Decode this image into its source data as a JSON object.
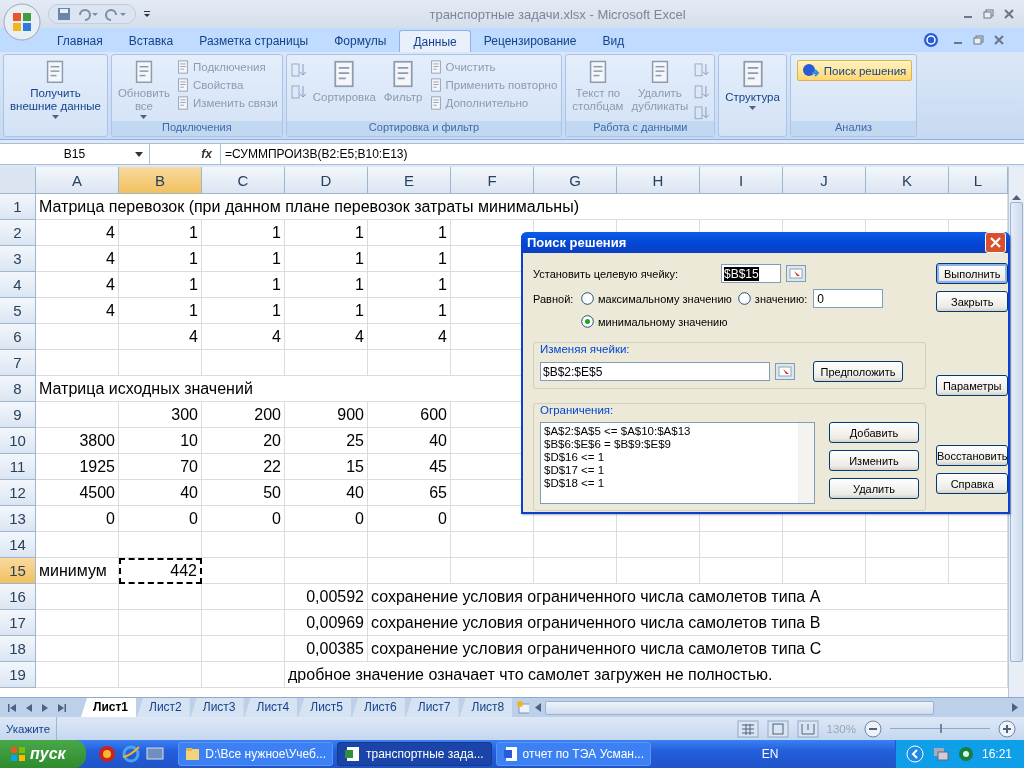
{
  "window": {
    "title": "транспортные задачи.xlsx - Microsoft Excel"
  },
  "tabs": [
    {
      "label": "Главная",
      "selected": false
    },
    {
      "label": "Вставка",
      "selected": false
    },
    {
      "label": "Разметка страницы",
      "selected": false
    },
    {
      "label": "Формулы",
      "selected": false
    },
    {
      "label": "Данные",
      "selected": true
    },
    {
      "label": "Рецензирование",
      "selected": false
    },
    {
      "label": "Вид",
      "selected": false
    }
  ],
  "ribbon": [
    {
      "items": [
        {
          "kind": "large",
          "label": "Получить\nвнешние данные",
          "disabled": false,
          "dropdown": true
        }
      ]
    },
    {
      "label": "Подключения",
      "items": [
        {
          "kind": "large",
          "label": "Обновить\nвсе",
          "disabled": true,
          "dropdown": true
        },
        {
          "kind": "stack",
          "children": [
            {
              "label": "Подключения",
              "disabled": true
            },
            {
              "label": "Свойства",
              "disabled": true
            },
            {
              "label": "Изменить связи",
              "disabled": true
            }
          ]
        }
      ]
    },
    {
      "label": "Сортировка и фильтр",
      "items": [
        {
          "kind": "sorticons",
          "disabled": true
        },
        {
          "kind": "large",
          "label": "Сортировка",
          "disabled": true,
          "dropdown": false
        },
        {
          "kind": "large",
          "label": "Фильтр",
          "disabled": true,
          "dropdown": false
        },
        {
          "kind": "stack",
          "children": [
            {
              "label": "Очистить",
              "disabled": true
            },
            {
              "label": "Применить повторно",
              "disabled": true
            },
            {
              "label": "Дополнительно",
              "disabled": true
            }
          ]
        }
      ]
    },
    {
      "label": "Работа с данными",
      "items": [
        {
          "kind": "large",
          "label": "Текст по\nстолбцам",
          "disabled": true,
          "dropdown": false
        },
        {
          "kind": "large",
          "label": "Удалить\nдубликаты",
          "disabled": true,
          "dropdown": false
        },
        {
          "kind": "toolicons",
          "disabled": true
        }
      ]
    },
    {
      "items": [
        {
          "kind": "large",
          "label": "Структура",
          "disabled": false,
          "dropdown": true
        }
      ]
    },
    {
      "label": "Анализ",
      "items": [
        {
          "kind": "highlight",
          "label": "Поиск решения",
          "disabled": false
        }
      ]
    }
  ],
  "formula_bar": {
    "name_box": "B15",
    "fx": "fx",
    "formula": "=СУММПРОИЗВ(B2:E5;B10:E13)"
  },
  "columns": [
    "A",
    "B",
    "C",
    "D",
    "E",
    "F",
    "G",
    "H",
    "I",
    "J",
    "K",
    "L"
  ],
  "rows": [
    {
      "header": "1",
      "cells": [
        {
          "text": "Матрица перевозок (при данном плане перевозок затраты минимальны)",
          "kind": "text"
        }
      ]
    },
    {
      "header": "2",
      "cells": [
        {
          "text": "4",
          "kind": "number"
        },
        {
          "text": "1",
          "kind": "number"
        },
        {
          "text": "1",
          "kind": "number"
        },
        {
          "text": "1",
          "kind": "number"
        },
        {
          "text": "1",
          "kind": "number"
        }
      ]
    },
    {
      "header": "3",
      "cells": [
        {
          "text": "4",
          "kind": "number"
        },
        {
          "text": "1",
          "kind": "number"
        },
        {
          "text": "1",
          "kind": "number"
        },
        {
          "text": "1",
          "kind": "number"
        },
        {
          "text": "1",
          "kind": "number"
        }
      ]
    },
    {
      "header": "4",
      "cells": [
        {
          "text": "4",
          "kind": "number"
        },
        {
          "text": "1",
          "kind": "number"
        },
        {
          "text": "1",
          "kind": "number"
        },
        {
          "text": "1",
          "kind": "number"
        },
        {
          "text": "1",
          "kind": "number"
        }
      ]
    },
    {
      "header": "5",
      "cells": [
        {
          "text": "4",
          "kind": "number"
        },
        {
          "text": "1",
          "kind": "number"
        },
        {
          "text": "1",
          "kind": "number"
        },
        {
          "text": "1",
          "kind": "number"
        },
        {
          "text": "1",
          "kind": "number"
        }
      ]
    },
    {
      "header": "6",
      "cells": [
        null,
        {
          "text": "4",
          "kind": "number"
        },
        {
          "text": "4",
          "kind": "number"
        },
        {
          "text": "4",
          "kind": "number"
        },
        {
          "text": "4",
          "kind": "number"
        }
      ]
    },
    {
      "header": "7",
      "cells": []
    },
    {
      "header": "8",
      "cells": [
        {
          "text": "Матрица исходных значений",
          "kind": "text"
        }
      ]
    },
    {
      "header": "9",
      "cells": [
        null,
        {
          "text": "300",
          "kind": "number"
        },
        {
          "text": "200",
          "kind": "number"
        },
        {
          "text": "900",
          "kind": "number"
        },
        {
          "text": "600",
          "kind": "number"
        }
      ]
    },
    {
      "header": "10",
      "cells": [
        {
          "text": "3800",
          "kind": "number"
        },
        {
          "text": "10",
          "kind": "number"
        },
        {
          "text": "20",
          "kind": "number"
        },
        {
          "text": "25",
          "kind": "number"
        },
        {
          "text": "40",
          "kind": "number"
        }
      ]
    },
    {
      "header": "11",
      "cells": [
        {
          "text": "1925",
          "kind": "number"
        },
        {
          "text": "70",
          "kind": "number"
        },
        {
          "text": "22",
          "kind": "number"
        },
        {
          "text": "15",
          "kind": "number"
        },
        {
          "text": "45",
          "kind": "number"
        }
      ]
    },
    {
      "header": "12",
      "cells": [
        {
          "text": "4500",
          "kind": "number"
        },
        {
          "text": "40",
          "kind": "number"
        },
        {
          "text": "50",
          "kind": "number"
        },
        {
          "text": "40",
          "kind": "number"
        },
        {
          "text": "65",
          "kind": "number"
        }
      ]
    },
    {
      "header": "13",
      "cells": [
        {
          "text": "0",
          "kind": "number"
        },
        {
          "text": "0",
          "kind": "number"
        },
        {
          "text": "0",
          "kind": "number"
        },
        {
          "text": "0",
          "kind": "number"
        },
        {
          "text": "0",
          "kind": "number"
        }
      ]
    },
    {
      "header": "14",
      "cells": []
    },
    {
      "header": "15",
      "cells": [
        {
          "text": "минимум",
          "kind": "text"
        },
        {
          "text": "442",
          "kind": "number",
          "selected": true
        }
      ]
    },
    {
      "header": "16",
      "cells": [
        null,
        null,
        null,
        {
          "text": "0,00592",
          "kind": "number"
        },
        {
          "text": "сохранение условия ограниченного числа самолетов типа А",
          "kind": "text"
        }
      ]
    },
    {
      "header": "17",
      "cells": [
        null,
        null,
        null,
        {
          "text": "0,00969",
          "kind": "number"
        },
        {
          "text": "сохранение условия ограниченного числа самолетов типа В",
          "kind": "text"
        }
      ]
    },
    {
      "header": "18",
      "cells": [
        null,
        null,
        null,
        {
          "text": "0,00385",
          "kind": "number"
        },
        {
          "text": "сохранение условия ограниченного числа самолетов типа С",
          "kind": "text"
        }
      ]
    },
    {
      "header": "19",
      "cells": [
        null,
        null,
        null,
        {
          "text": "дробное значение означает что самолет загружен не полностью.",
          "kind": "text"
        }
      ]
    }
  ],
  "sheet_tabs": [
    {
      "label": "Лист1",
      "selected": true
    },
    {
      "label": "Лист2",
      "selected": false
    },
    {
      "label": "Лист3",
      "selected": false
    },
    {
      "label": "Лист4",
      "selected": false
    },
    {
      "label": "Лист5",
      "selected": false
    },
    {
      "label": "Лист6",
      "selected": false
    },
    {
      "label": "Лист7",
      "selected": false
    },
    {
      "label": "Лист8",
      "selected": false
    }
  ],
  "status_bar": {
    "mode": "Укажите",
    "zoom": "130%",
    "level": 0.5
  },
  "dialog": {
    "title": "Поиск решения",
    "target_label": "Установить целевую ячейку:",
    "target_value": "$B$15",
    "equal_label": "Равной:",
    "options": [
      {
        "label": "максимальному значению",
        "selected": false
      },
      {
        "label": "значению:",
        "selected": false,
        "value": "0"
      },
      {
        "label": "минимальному значению",
        "selected": true
      }
    ],
    "changing_label": "Изменяя ячейки:",
    "changing_value": "$B$2:$E$5",
    "guess_button": "Предположить",
    "constraints_label": "Ограничения:",
    "constraints": [
      "$A$2:$A$5 <= $A$10:$A$13",
      "$B$6:$E$6 = $B$9:$E$9",
      "$D$16 <= 1",
      "$D$17 <= 1",
      "$D$18 <= 1"
    ],
    "constraint_buttons": [
      "Добавить",
      "Изменить",
      "Удалить"
    ],
    "side_buttons": [
      "Выполнить",
      "Закрыть",
      "Параметры",
      "Восстановить",
      "Справка"
    ]
  },
  "taskbar": {
    "start": "пуск",
    "tasks": [
      {
        "label": "D:\\Все нужное\\Учеб...",
        "kind": "folder",
        "selected": false
      },
      {
        "label": "транспортные зада...",
        "kind": "excel",
        "selected": true
      },
      {
        "label": "отчет по ТЭА Усман...",
        "kind": "word",
        "selected": false
      }
    ],
    "language": "EN",
    "time": "16:21"
  }
}
